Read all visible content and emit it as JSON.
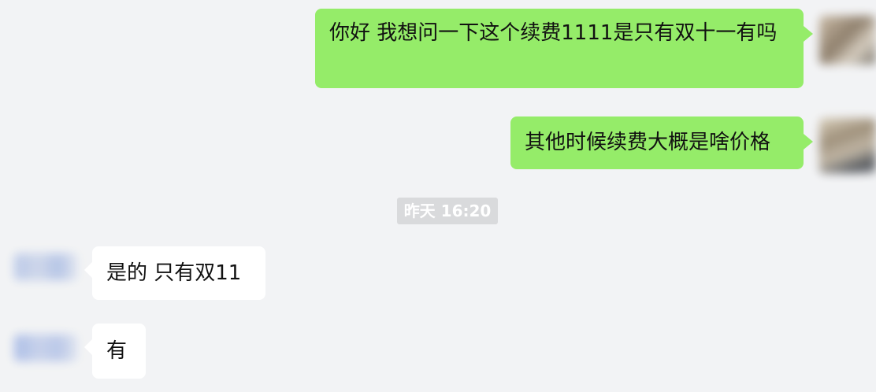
{
  "messages": [
    {
      "direction": "out",
      "text": "你好  我想问一下这个续费1111是只有双十一有吗"
    },
    {
      "direction": "out",
      "text": "其他时候续费大概是啥价格"
    },
    {
      "direction": "in",
      "text": "是的 只有双11"
    },
    {
      "direction": "in",
      "text": "有"
    }
  ],
  "timestamp": "昨天 16:20",
  "colors": {
    "background": "#f2f3f5",
    "outgoing_bubble": "#95ec69",
    "incoming_bubble": "#ffffff",
    "timestamp_bg": "#d9dadc"
  }
}
